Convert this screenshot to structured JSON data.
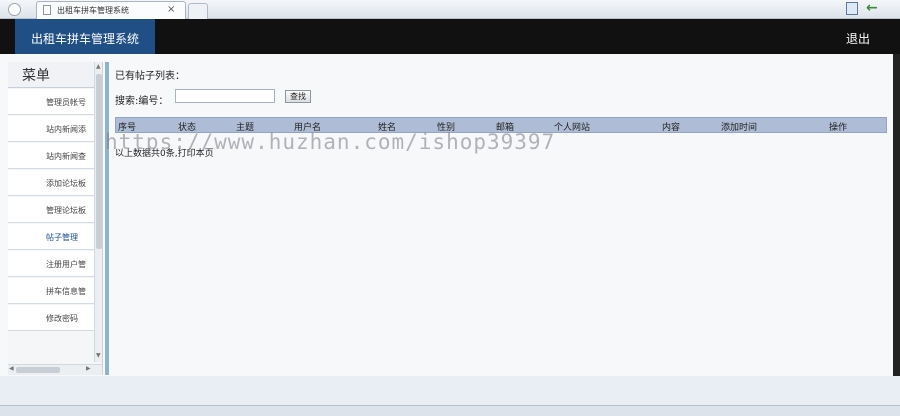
{
  "browser": {
    "tab_title": "出租车拼车管理系统",
    "tab_close": "×"
  },
  "header": {
    "title": "出租车拼车管理系统",
    "logout": "退出"
  },
  "sidebar": {
    "title": "菜单",
    "items": [
      {
        "label": "管理员帐号"
      },
      {
        "label": "站内新闻添"
      },
      {
        "label": "站内新闻查"
      },
      {
        "label": "添加论坛板"
      },
      {
        "label": "管理论坛板"
      },
      {
        "label": "帖子管理"
      },
      {
        "label": "注册用户管"
      },
      {
        "label": "拼车信息管"
      },
      {
        "label": "修改密码"
      }
    ]
  },
  "content": {
    "heading": "已有帖子列表：",
    "search_label": "搜索:编号：",
    "search_value": "",
    "search_button": "查找",
    "columns": [
      "序号",
      "状态",
      "主题",
      "用户名",
      "姓名",
      "性别",
      "邮箱",
      "个人网站",
      "内容",
      "添加时间",
      "操作"
    ],
    "summary": "以上数据共0条,打印本页"
  },
  "watermark": "https://www.huzhan.com/ishop39397"
}
